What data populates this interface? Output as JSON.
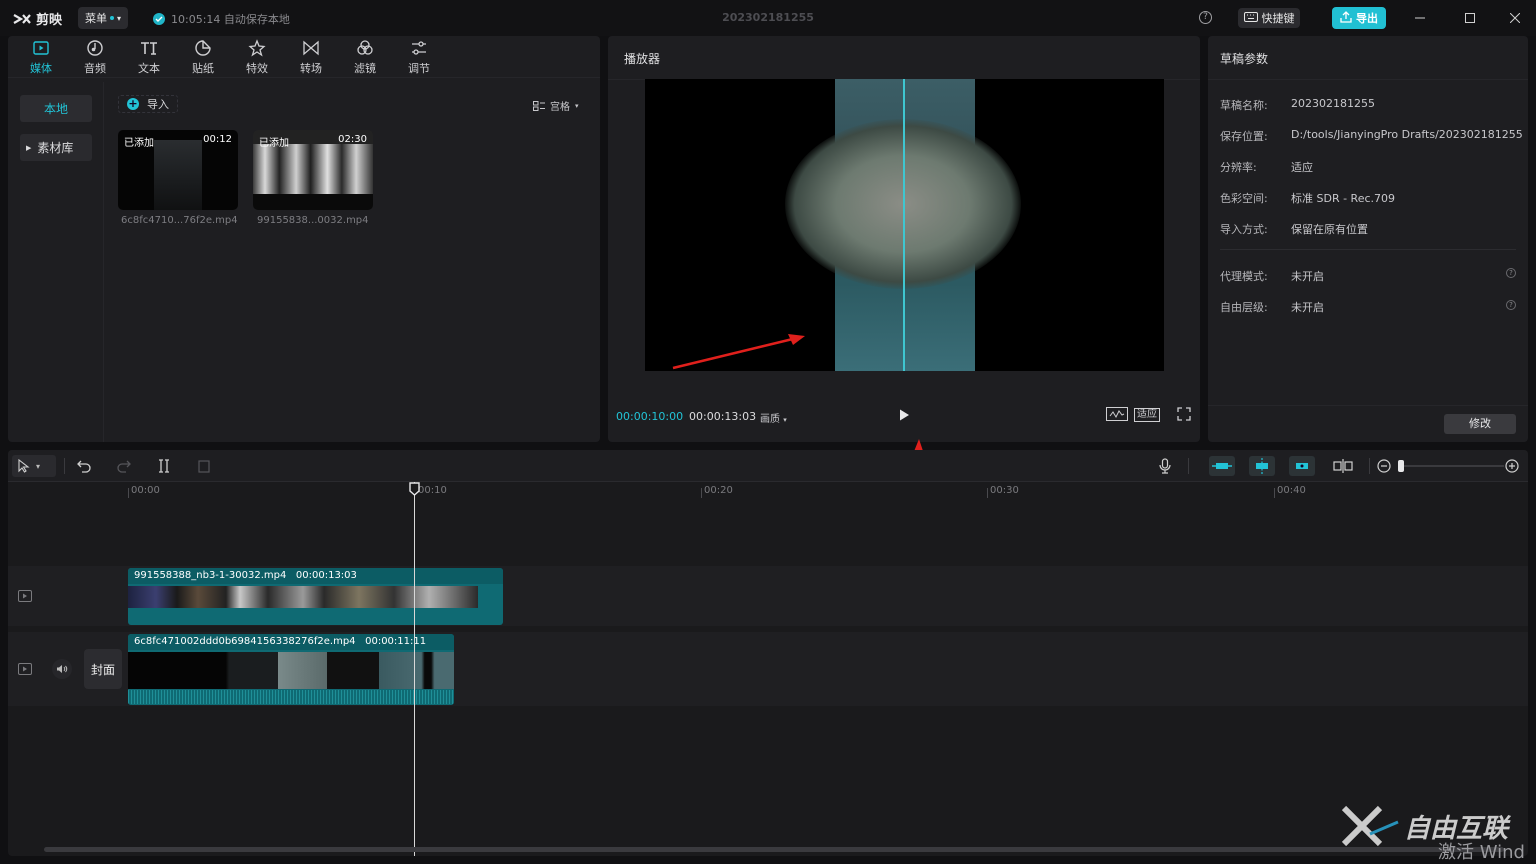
{
  "app": {
    "name": "剪映",
    "menu_label": "菜单",
    "autosave_text": "10:05:14 自动保存本地",
    "project_title": "202302181255",
    "shortcut_label": "快捷键",
    "export_label": "导出"
  },
  "media_tabs": [
    {
      "label": "媒体",
      "icon": "media-icon"
    },
    {
      "label": "音频",
      "icon": "audio-icon"
    },
    {
      "label": "文本",
      "icon": "text-icon"
    },
    {
      "label": "贴纸",
      "icon": "sticker-icon"
    },
    {
      "label": "特效",
      "icon": "effects-icon"
    },
    {
      "label": "转场",
      "icon": "transition-icon"
    },
    {
      "label": "滤镜",
      "icon": "filter-icon"
    },
    {
      "label": "调节",
      "icon": "adjust-icon"
    }
  ],
  "media_sidebar": {
    "local": "本地",
    "library": "素材库"
  },
  "media_toolbar": {
    "import": "导入",
    "sort": "宫格"
  },
  "media_items": [
    {
      "badge": "已添加",
      "duration": "00:12",
      "filename": "6c8fc4710...76f2e.mp4"
    },
    {
      "badge": "已添加",
      "duration": "02:30",
      "filename": "99155838...0032.mp4"
    }
  ],
  "player": {
    "title": "播放器",
    "current_time": "00:00:10:00",
    "total_time": "00:00:13:03",
    "quality": "画质",
    "fit": "适应"
  },
  "params": {
    "title": "草稿参数",
    "rows": [
      {
        "label": "草稿名称:",
        "value": "202302181255"
      },
      {
        "label": "保存位置:",
        "value": "D:/tools/JianyingPro Drafts/202302181255"
      },
      {
        "label": "分辨率:",
        "value": "适应"
      },
      {
        "label": "色彩空间:",
        "value": "标准 SDR - Rec.709"
      },
      {
        "label": "导入方式:",
        "value": "保留在原有位置"
      },
      {
        "label": "代理模式:",
        "value": "未开启"
      },
      {
        "label": "自由层级:",
        "value": "未开启"
      }
    ],
    "modify_label": "修改"
  },
  "timeline": {
    "ruler": [
      "00:00",
      "00:10",
      "00:20",
      "00:30",
      "00:40"
    ],
    "clips": [
      {
        "name": "991558388_nb3-1-30032.mp4",
        "duration": "00:00:13:03"
      },
      {
        "name": "6c8fc471002ddd0b6984156338276f2e.mp4",
        "duration": "00:00:11:11"
      }
    ],
    "cover_label": "封面"
  },
  "watermark": {
    "brand": "自由互联",
    "windows": "激活 Wind"
  },
  "colors": {
    "accent": "#22c3d6",
    "export": "#21c0d3",
    "clip": "#0f6a73"
  }
}
